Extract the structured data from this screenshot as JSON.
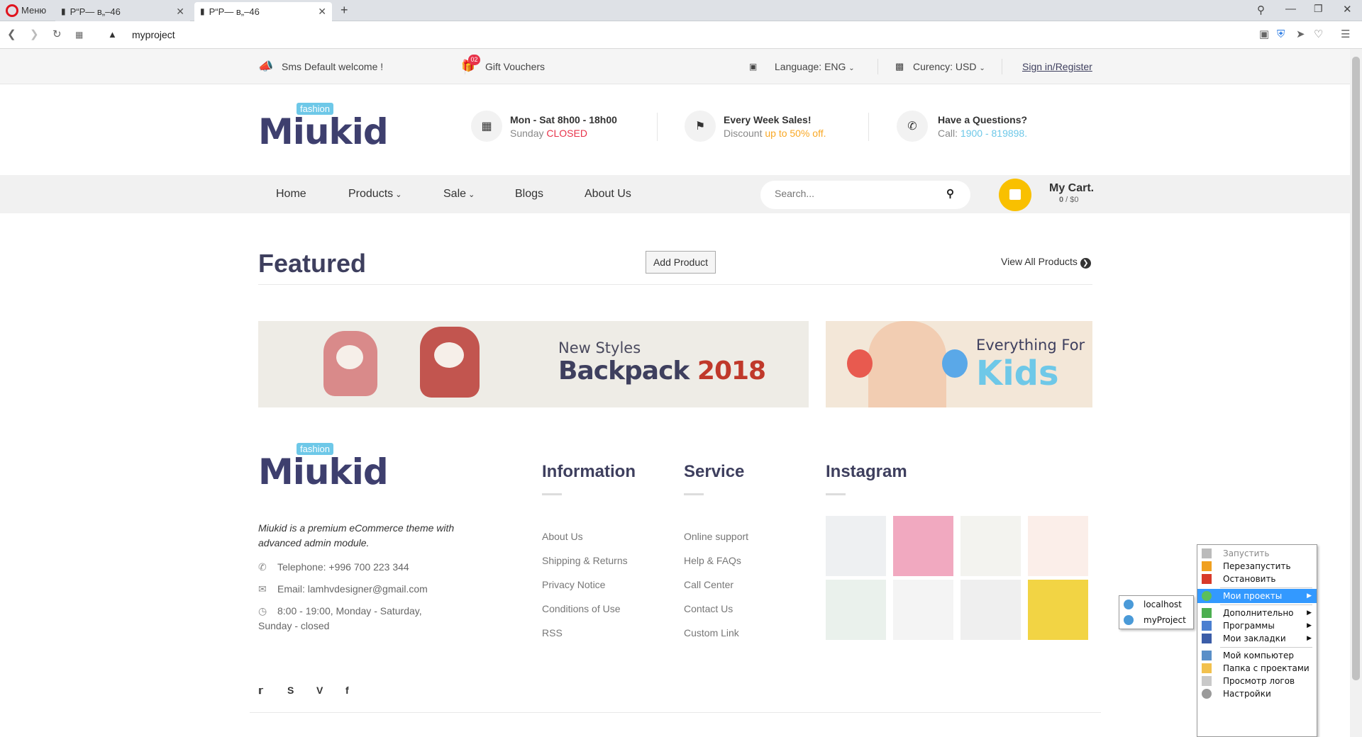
{
  "browser": {
    "menu_label": "Меню",
    "tabs": [
      {
        "title": "Р“Р— в„–46"
      },
      {
        "title": "Р“Р— в„–46"
      }
    ],
    "address": "myproject"
  },
  "topbar": {
    "welcome": "Sms Default welcome !",
    "vouchers_badge": "02",
    "vouchers": "Gift Vouchers",
    "language": "Language: ENG",
    "currency": "Curency: USD",
    "signin": "Sign in/Register"
  },
  "header": {
    "logo_badge": "fashion",
    "logo_text": "Miukid",
    "hours_title": "Mon - Sat 8h00 - 18h00",
    "hours_sub_prefix": "Sunday ",
    "hours_sub_highlight": "CLOSED",
    "sales_title": "Every Week Sales!",
    "sales_sub_prefix": "Discount ",
    "sales_sub_highlight": "up to 50% off.",
    "question_title": "Have a Questions?",
    "question_sub_prefix": "Call: ",
    "question_sub_highlight": "1900 - 819898."
  },
  "nav": {
    "items": [
      "Home",
      "Products",
      "Sale",
      "Blogs",
      "About Us"
    ],
    "search_placeholder": "Search...",
    "cart_title": "My Cart.",
    "cart_count": "0",
    "cart_total": " / $0"
  },
  "featured": {
    "title": "Featured",
    "add_button": "Add Product",
    "view_all": "View All Products"
  },
  "banners": {
    "left_line1": "New Styles",
    "left_line2a": "Backpack ",
    "left_line2b": "2018",
    "right_line1": "Everything For",
    "right_line2": "Kids"
  },
  "footer": {
    "logo_badge": "fashion",
    "logo_text": "Miukid",
    "about": "Miukid is a premium eCommerce theme with advanced admin module.",
    "telephone": "Telephone: +996 700 223 344",
    "email": "Email: lamhvdesigner@gmail.com",
    "hours_line1": "8:00 - 19:00, Monday - Saturday,",
    "hours_line2": "Sunday - closed",
    "information_title": "Information",
    "information_links": [
      "About Us",
      "Shipping & Returns",
      "Privacy Notice",
      "Conditions of Use",
      "RSS"
    ],
    "service_title": "Service",
    "service_links": [
      "Online support",
      "Help & FAQs",
      "Call Center",
      "Contact Us",
      "Custom Link"
    ],
    "instagram_title": "Instagram"
  },
  "context_menu": {
    "items": [
      "Запустить",
      "Перезапустить",
      "Остановить",
      "Мои проекты",
      "Дополнительно",
      "Программы",
      "Мои закладки",
      "Мой компьютер",
      "Папка с проектами",
      "Просмотр логов",
      "Настройки"
    ],
    "submenu": [
      "localhost",
      "myProject"
    ]
  },
  "colors": {
    "accent_red": "#e8334a",
    "accent_orange": "#f9a825",
    "accent_blue": "#6ec8e8",
    "cart_yellow": "#f9c000",
    "heading": "#3e3f5e"
  }
}
